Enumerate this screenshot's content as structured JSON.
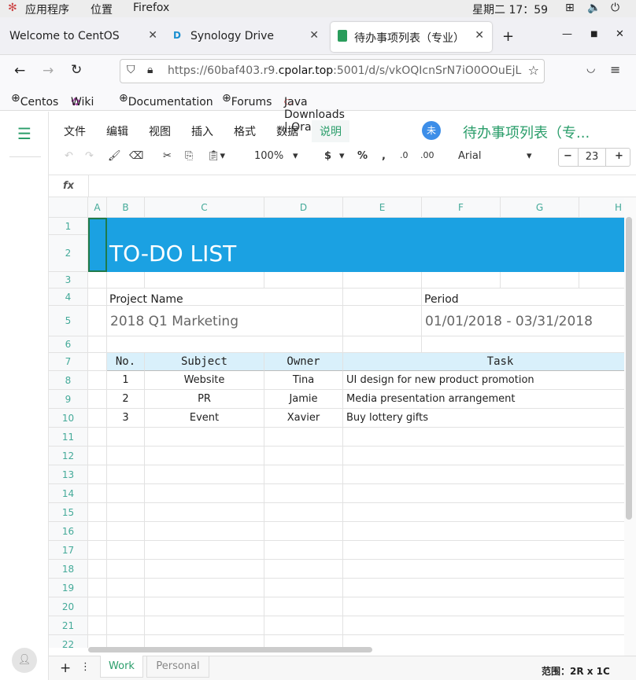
{
  "system": {
    "apps": "应用程序",
    "places": "位置",
    "app": "Firefox",
    "clock": "星期二 17：59"
  },
  "browser": {
    "tabs": [
      {
        "label": "Welcome to CentOS"
      },
      {
        "label": "Synology Drive"
      },
      {
        "label": "待办事项列表（专业）"
      }
    ],
    "url_prefix": "https://60baf403.r9.",
    "url_host": "cpolar.top",
    "url_rest": ":5001/d/s/vkOQIcnSrN7iO0OOuEjL",
    "bookmarks": [
      "Centos",
      "Wiki",
      "Documentation",
      "Forums",
      "Java Downloads | Oracle"
    ]
  },
  "app": {
    "menu": [
      "文件",
      "编辑",
      "视图",
      "插入",
      "格式",
      "数据",
      "说明"
    ],
    "avatar": "未",
    "doc_title": "待办事项列表（专...",
    "toolbar": {
      "zoom": "100%",
      "currency": "$",
      "percent": "%",
      "comma": ",",
      "dec_less": ".0",
      "dec_more": ".00",
      "font": "Arial",
      "font_size": "23"
    },
    "fx": "fx"
  },
  "sheet": {
    "columns": [
      "A",
      "B",
      "C",
      "D",
      "E",
      "F",
      "G",
      "H"
    ],
    "rows": [
      "1",
      "2",
      "3",
      "4",
      "5",
      "6",
      "7",
      "8",
      "9",
      "10",
      "11",
      "12",
      "13",
      "14",
      "15",
      "16",
      "17",
      "18",
      "19",
      "20",
      "21",
      "22"
    ],
    "title": "TO-DO LIST",
    "project_label": "Project Name",
    "project_value": "2018 Q1 Marketing",
    "period_label": "Period",
    "period_value": "01/01/2018 - 03/31/2018",
    "table_headers": [
      "No.",
      "Subject",
      "Owner",
      "Task"
    ],
    "table_rows": [
      [
        "1",
        "Website",
        "Tina",
        "UI design for new product promotion"
      ],
      [
        "2",
        "PR",
        "Jamie",
        "Media presentation arrangement"
      ],
      [
        "3",
        "Event",
        "Xavier",
        "Buy lottery gifts"
      ]
    ],
    "header_color": "#1ba1e2",
    "table_header_color": "#d9f0fb"
  },
  "footer": {
    "sheets": [
      "Work",
      "Personal"
    ],
    "active_sheet": "Work",
    "range": "范围：2R x 1C"
  }
}
